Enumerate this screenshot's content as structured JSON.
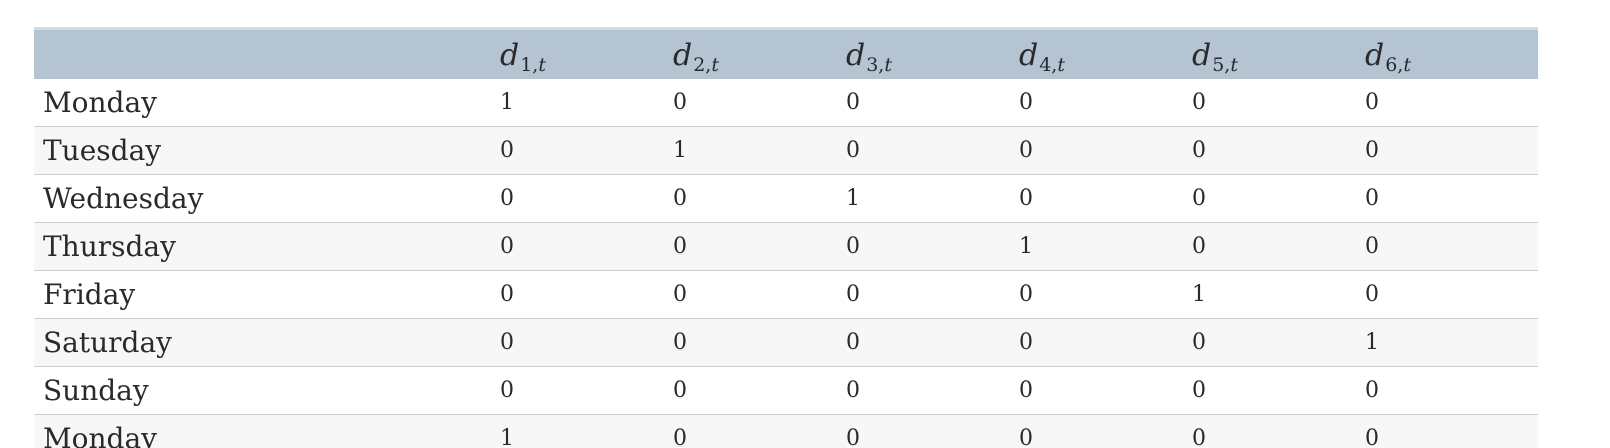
{
  "table": {
    "columns": [
      {
        "base": "d",
        "sub": "1,",
        "subvar": "t"
      },
      {
        "base": "d",
        "sub": "2,",
        "subvar": "t"
      },
      {
        "base": "d",
        "sub": "3,",
        "subvar": "t"
      },
      {
        "base": "d",
        "sub": "4,",
        "subvar": "t"
      },
      {
        "base": "d",
        "sub": "5,",
        "subvar": "t"
      },
      {
        "base": "d",
        "sub": "6,",
        "subvar": "t"
      }
    ],
    "rows": [
      {
        "label": "Monday",
        "values": [
          "1",
          "0",
          "0",
          "0",
          "0",
          "0"
        ]
      },
      {
        "label": "Tuesday",
        "values": [
          "0",
          "1",
          "0",
          "0",
          "0",
          "0"
        ]
      },
      {
        "label": "Wednesday",
        "values": [
          "0",
          "0",
          "1",
          "0",
          "0",
          "0"
        ]
      },
      {
        "label": "Thursday",
        "values": [
          "0",
          "0",
          "0",
          "1",
          "0",
          "0"
        ]
      },
      {
        "label": "Friday",
        "values": [
          "0",
          "0",
          "0",
          "0",
          "1",
          "0"
        ]
      },
      {
        "label": "Saturday",
        "values": [
          "0",
          "0",
          "0",
          "0",
          "0",
          "1"
        ]
      },
      {
        "label": "Sunday",
        "values": [
          "0",
          "0",
          "0",
          "0",
          "0",
          "0"
        ]
      },
      {
        "label": "Monday",
        "values": [
          "1",
          "0",
          "0",
          "0",
          "0",
          "0"
        ]
      }
    ]
  }
}
